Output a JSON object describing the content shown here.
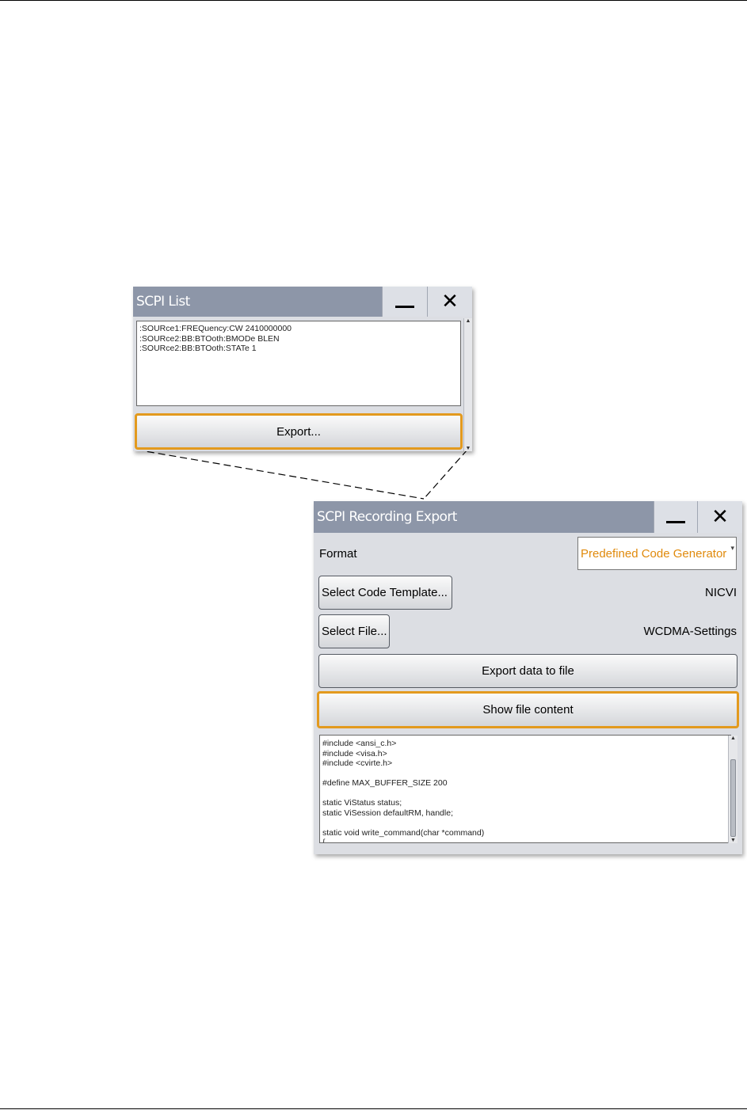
{
  "scpi_list": {
    "title": "SCPI List",
    "lines": [
      ":SOURce1:FREQuency:CW 2410000000",
      ":SOURce2:BB:BTOoth:BMODe BLEN",
      ":SOURce2:BB:BTOoth:STATe 1"
    ],
    "export_label": "Export..."
  },
  "export_dialog": {
    "title": "SCPI Recording Export",
    "format_label": "Format",
    "format_value": "Predefined Code Generator",
    "select_template_label": "Select Code Template...",
    "template_value": "NICVI",
    "select_file_label": "Select File...",
    "file_value": "WCDMA-Settings",
    "export_data_label": "Export data to file",
    "show_content_label": "Show file content",
    "code_lines": [
      "#include <ansi_c.h>",
      "#include <visa.h>",
      "#include <cvirte.h>",
      "",
      "#define MAX_BUFFER_SIZE 200",
      "",
      "static ViStatus status;",
      "static ViSession defaultRM, handle;",
      "",
      "static void write_command(char *command)",
      "{"
    ]
  },
  "colors": {
    "titlebar": "#8d96a8",
    "focus": "#e39a1e",
    "accent_text": "#e08a0c"
  }
}
